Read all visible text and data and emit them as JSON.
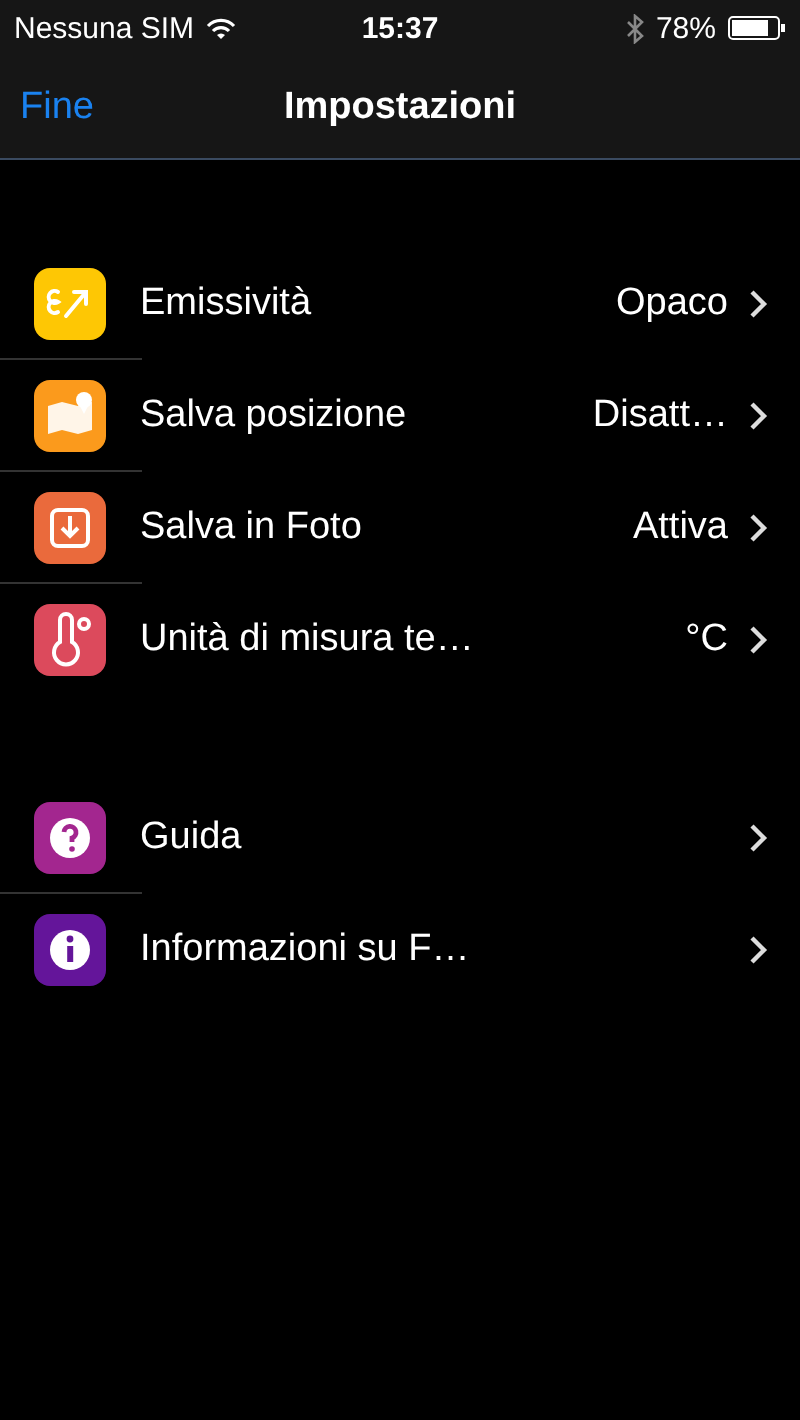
{
  "status_bar": {
    "carrier": "Nessuna SIM",
    "time": "15:37",
    "battery": "78%"
  },
  "nav": {
    "back": "Fine",
    "title": "Impostazioni"
  },
  "sections": [
    {
      "items": [
        {
          "label": "Emissività",
          "value": "Opaco",
          "color": "#fec704"
        },
        {
          "label": "Salva posizione",
          "value": "Disatt…",
          "color": "#fb9a1c"
        },
        {
          "label": "Salva in Foto",
          "value": "Attiva",
          "color": "#ea6a3c"
        },
        {
          "label": "Unità di misura te…",
          "value": "°C",
          "color": "#dc4a5c"
        }
      ]
    },
    {
      "items": [
        {
          "label": "Guida",
          "color": "#a3268f"
        },
        {
          "label": "Informazioni su F…",
          "color": "#64159a"
        }
      ]
    }
  ]
}
